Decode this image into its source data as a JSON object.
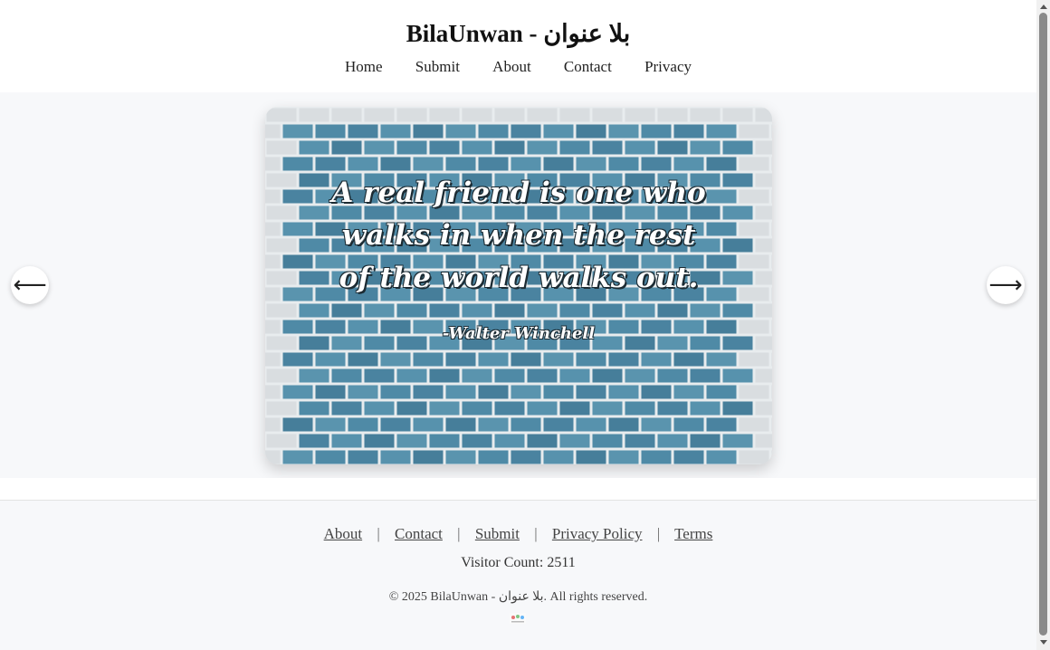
{
  "header": {
    "title": "BilaUnwan - بلا عنوان",
    "nav": [
      "Home",
      "Submit",
      "About",
      "Contact",
      "Privacy"
    ]
  },
  "slider": {
    "quote_lines": [
      "A real friend is one who",
      "walks in when the rest",
      "of the world walks out."
    ],
    "author": "-Walter Winchell",
    "prev_label": "⟵",
    "next_label": "⟶"
  },
  "footer": {
    "links": [
      "About",
      "Contact",
      "Submit",
      "Privacy Policy",
      "Terms"
    ],
    "separator": "|",
    "visitor_count": "Visitor Count: 2511",
    "copyright": "© 2025 BilaUnwan - بلا عنوان. All rights reserved."
  },
  "colors": {
    "brick_blue": "#4f8aa6",
    "mortar": "#e8ecee",
    "page_bg": "#f7f8fa"
  }
}
